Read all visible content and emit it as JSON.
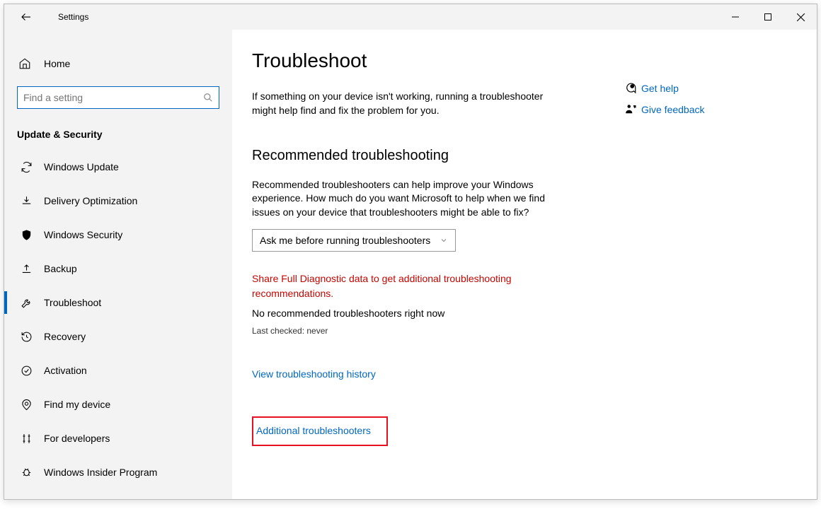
{
  "titlebar": {
    "title": "Settings"
  },
  "sidebar": {
    "home_label": "Home",
    "search_placeholder": "Find a setting",
    "section_title": "Update & Security",
    "items": [
      {
        "label": "Windows Update"
      },
      {
        "label": "Delivery Optimization"
      },
      {
        "label": "Windows Security"
      },
      {
        "label": "Backup"
      },
      {
        "label": "Troubleshoot"
      },
      {
        "label": "Recovery"
      },
      {
        "label": "Activation"
      },
      {
        "label": "Find my device"
      },
      {
        "label": "For developers"
      },
      {
        "label": "Windows Insider Program"
      }
    ],
    "selected_index": 4
  },
  "main": {
    "title": "Troubleshoot",
    "intro": "If something on your device isn't working, running a troubleshooter might help find and fix the problem for you.",
    "recommended": {
      "heading": "Recommended troubleshooting",
      "body": "Recommended troubleshooters can help improve your Windows experience. How much do you want Microsoft to help when we find issues on your device that troubleshooters might be able to fix?",
      "dropdown_value": "Ask me before running troubleshooters",
      "warning": "Share Full Diagnostic data to get additional troubleshooting recommendations.",
      "no_rec": "No recommended troubleshooters right now",
      "last_checked": "Last checked: never"
    },
    "history_link": "View troubleshooting history",
    "additional_link": "Additional troubleshooters"
  },
  "rightcol": {
    "help_label": "Get help",
    "feedback_label": "Give feedback"
  }
}
